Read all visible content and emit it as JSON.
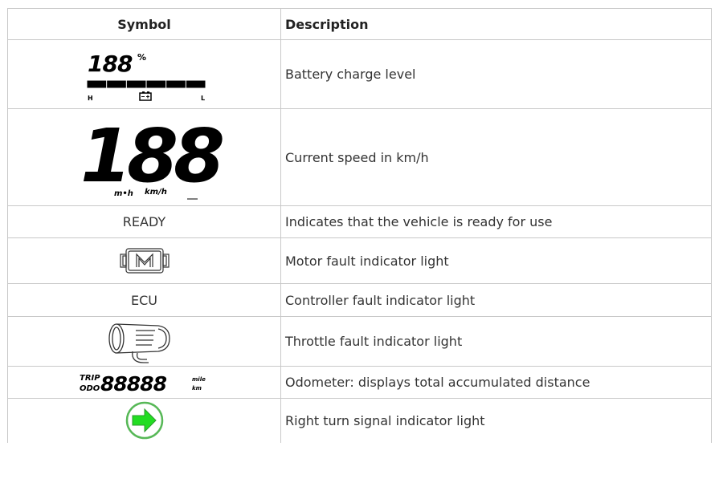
{
  "header": {
    "symbol": "Symbol",
    "description": "Description"
  },
  "rows": [
    {
      "icon": "battery-level-display-icon",
      "display_digits": "188",
      "percent": "%",
      "scale_high": "H",
      "scale_low": "L",
      "level": 1.0,
      "description": "Battery charge level"
    },
    {
      "icon": "speed-display-icon",
      "display_digits": "188",
      "unit_mph": "m•h",
      "unit_kmh": "km/h",
      "description": "Current speed in km/h"
    },
    {
      "symbol_text": "READY",
      "description": "Indicates that the vehicle is ready for use"
    },
    {
      "icon": "motor-fault-icon",
      "description": "Motor fault indicator light"
    },
    {
      "symbol_text": "ECU",
      "description": "Controller fault indicator light"
    },
    {
      "icon": "throttle-fault-icon",
      "description": "Throttle fault indicator light"
    },
    {
      "icon": "odometer-display-icon",
      "trip": "TRIP",
      "odo": "ODO",
      "display_digits": "88888",
      "unit_mile": "mile",
      "unit_km": "km",
      "description": "Odometer: displays total accumulated distance"
    },
    {
      "icon": "right-turn-arrow-icon",
      "arrow_color": "#22dd22",
      "ring_color": "#57b857",
      "description": "Right turn signal indicator light"
    }
  ]
}
